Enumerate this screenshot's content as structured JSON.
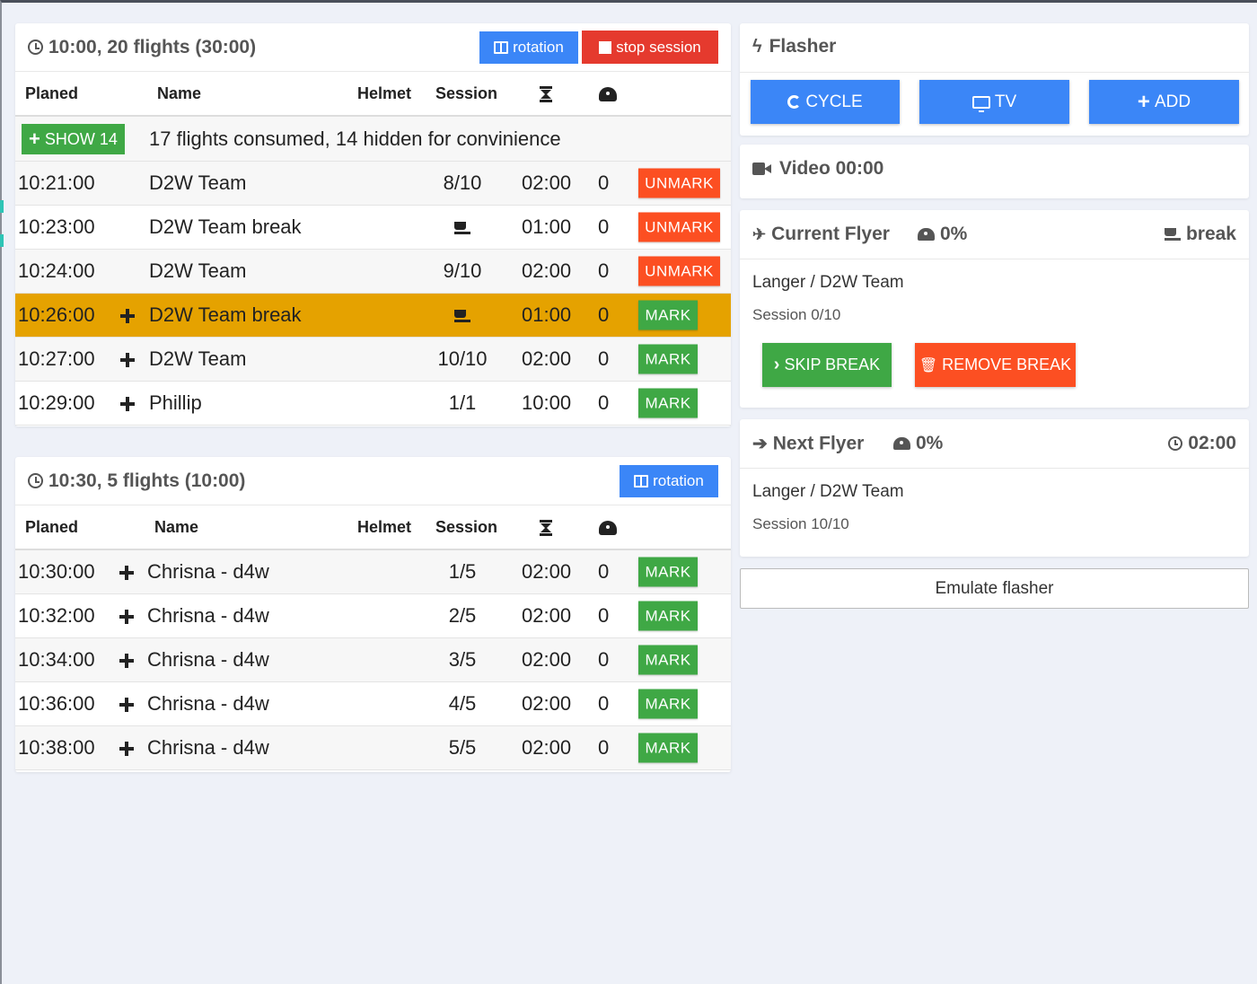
{
  "columns": {
    "planed": "Planed",
    "name": "Name",
    "helmet": "Helmet",
    "session": "Session"
  },
  "session1": {
    "title": "10:00, 20 flights (30:00)",
    "rotation_label": "rotation",
    "stop_label": "stop session",
    "show_label": "SHOW 14",
    "consumed_text": "17 flights consumed, 14 hidden for convinience",
    "rows": [
      {
        "time": "10:21:00",
        "name": "D2W Team",
        "session": "8/10",
        "duration": "02:00",
        "count": "0",
        "action": "UNMARK"
      },
      {
        "time": "10:23:00",
        "name": "D2W Team break",
        "session": "",
        "duration": "01:00",
        "count": "0",
        "action": "UNMARK"
      },
      {
        "time": "10:24:00",
        "name": "D2W Team",
        "session": "9/10",
        "duration": "02:00",
        "count": "0",
        "action": "UNMARK"
      },
      {
        "time": "10:26:00",
        "name": "D2W Team break",
        "session": "",
        "duration": "01:00",
        "count": "0",
        "action": "MARK"
      },
      {
        "time": "10:27:00",
        "name": "D2W Team",
        "session": "10/10",
        "duration": "02:00",
        "count": "0",
        "action": "MARK"
      },
      {
        "time": "10:29:00",
        "name": "Phillip",
        "session": "1/1",
        "duration": "10:00",
        "count": "0",
        "action": "MARK"
      }
    ]
  },
  "session2": {
    "title": "10:30, 5 flights (10:00)",
    "rotation_label": "rotation",
    "rows": [
      {
        "time": "10:30:00",
        "name": "Chrisna - d4w",
        "session": "1/5",
        "duration": "02:00",
        "count": "0",
        "action": "MARK"
      },
      {
        "time": "10:32:00",
        "name": "Chrisna - d4w",
        "session": "2/5",
        "duration": "02:00",
        "count": "0",
        "action": "MARK"
      },
      {
        "time": "10:34:00",
        "name": "Chrisna - d4w",
        "session": "3/5",
        "duration": "02:00",
        "count": "0",
        "action": "MARK"
      },
      {
        "time": "10:36:00",
        "name": "Chrisna - d4w",
        "session": "4/5",
        "duration": "02:00",
        "count": "0",
        "action": "MARK"
      },
      {
        "time": "10:38:00",
        "name": "Chrisna - d4w",
        "session": "5/5",
        "duration": "02:00",
        "count": "0",
        "action": "MARK"
      }
    ]
  },
  "flasher": {
    "title": "Flasher",
    "cycle_label": "CYCLE",
    "tv_label": "TV",
    "add_label": "ADD"
  },
  "video": {
    "title": "Video 00:00"
  },
  "current_flyer": {
    "title": "Current Flyer",
    "percent": "0%",
    "status": "break",
    "name": "Langer / D2W Team",
    "session": "Session 0/10",
    "skip_label": "SKIP BREAK",
    "remove_label": "REMOVE BREAK"
  },
  "next_flyer": {
    "title": "Next Flyer",
    "percent": "0%",
    "time": "02:00",
    "name": "Langer / D2W Team",
    "session": "Session 10/10"
  },
  "emulate_label": "Emulate flasher",
  "colors": {
    "blue": "#3b86f7",
    "red": "#e53a2e",
    "green": "#3fa845",
    "orange": "#fc4f22",
    "highlight": "#e5a200",
    "background": "#eef1f8"
  }
}
